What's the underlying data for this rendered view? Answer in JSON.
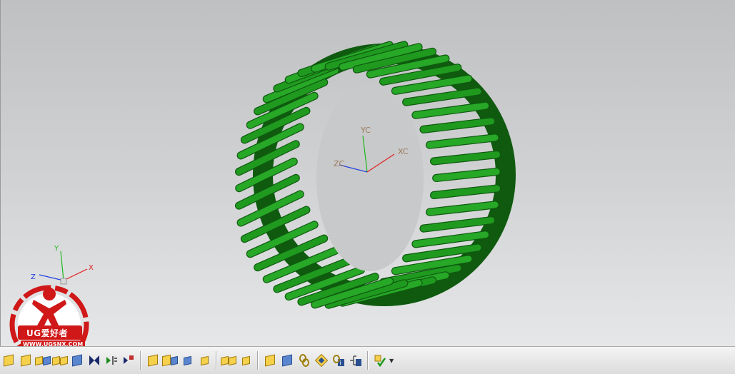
{
  "wcs": {
    "x_label": "XC",
    "y_label": "YC",
    "z_label": "ZC"
  },
  "absolute_triad": {
    "x_label": "X",
    "y_label": "Y",
    "z_label": "Z"
  },
  "watermark": {
    "title": "UG爱好者",
    "url": "WWW.UGSNX.COM"
  },
  "model": {
    "color": "#1f9a1f",
    "dark_color": "#0f5a0f",
    "slot_count": 44
  },
  "toolbar": {
    "icons": [
      "add-component-icon",
      "new-component-icon",
      "mirror-assembly-icon",
      "array-component-icon",
      "move-component-icon",
      "assembly-constraints-icon",
      "mate-component-icon",
      "reposition-icon",
      "show-hide-constraints-icon",
      "replace-component-icon",
      "make-unique-icon",
      "wave-geometry-linker-icon",
      "interpart-link-icon",
      "deformable-part-icon",
      "component-pattern-icon",
      "explode-view-icon",
      "sequence-icon",
      "assembly-navigator-icon",
      "clearance-analysis-icon",
      "wave-manager-icon",
      "check-mate-icon"
    ]
  }
}
